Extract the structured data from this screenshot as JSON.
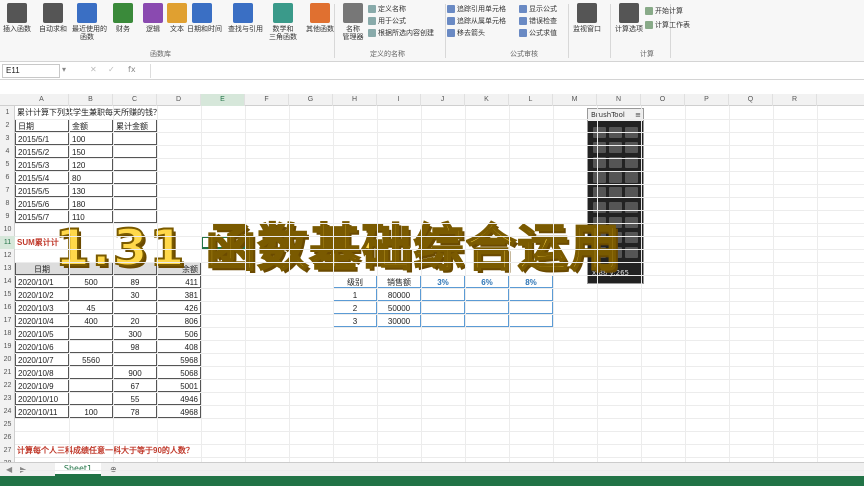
{
  "ribbon": {
    "buttons": [
      {
        "label": "插入函数",
        "color": "#555"
      },
      {
        "label": "自动求和",
        "color": "#555"
      },
      {
        "label": "最近使用的\n函数",
        "color": "#3a6fc4"
      },
      {
        "label": "财务",
        "color": "#3a8a3a"
      },
      {
        "label": "逻辑",
        "color": "#8a4ab0"
      },
      {
        "label": "文本",
        "color": "#e0a030"
      },
      {
        "label": "日期和时间",
        "color": "#3a6fc4"
      },
      {
        "label": "查找与引用",
        "color": "#3a6fc4"
      },
      {
        "label": "数学和\n三角函数",
        "color": "#3a9a8a"
      },
      {
        "label": "其他函数",
        "color": "#e07030"
      },
      {
        "label": "名称\n管理器",
        "color": "#777"
      },
      {
        "label": "监视窗口",
        "color": "#555"
      },
      {
        "label": "计算选项",
        "color": "#555"
      }
    ],
    "groups": {
      "library": "函数库",
      "names": "定义的名称",
      "audit": "公式审核",
      "calc": "计算"
    },
    "names_items": [
      "定义名称",
      "用于公式",
      "根据所选内容创建"
    ],
    "audit_items": [
      "追踪引用单元格",
      "追踪从属单元格",
      "移去箭头",
      "显示公式",
      "错误检查",
      "公式求值"
    ],
    "calc_items": [
      "开始计算",
      "计算工作表"
    ]
  },
  "formula_bar": {
    "name_box": "E11",
    "fx": "fx",
    "value": ""
  },
  "columns": [
    "A",
    "B",
    "C",
    "D",
    "E",
    "F",
    "G",
    "H",
    "I",
    "J",
    "K",
    "L",
    "M",
    "N",
    "O",
    "P",
    "Q",
    "R"
  ],
  "rows": [
    "1",
    "2",
    "3",
    "4",
    "5",
    "6",
    "7",
    "8",
    "9",
    "10",
    "11",
    "12",
    "13",
    "14",
    "15",
    "16",
    "17",
    "18",
    "19",
    "20",
    "21",
    "22",
    "23",
    "24",
    "25",
    "26",
    "27",
    "28"
  ],
  "sheet": {
    "q1": "累计计算下列某学生兼职每天所赚的钱？",
    "t1_header": [
      "日期",
      "金额",
      "累计金额"
    ],
    "t1": [
      [
        "2015/5/1",
        "100"
      ],
      [
        "2015/5/2",
        "150"
      ],
      [
        "2015/5/3",
        "120"
      ],
      [
        "2015/5/4",
        "80"
      ],
      [
        "2015/5/5",
        "130"
      ],
      [
        "2015/5/6",
        "180"
      ],
      [
        "2015/5/7",
        "110"
      ]
    ],
    "q2": "SUM累计计",
    "t2_header": [
      "日期",
      "余额"
    ],
    "t2": [
      [
        "2020/10/1",
        "500",
        "89",
        "411"
      ],
      [
        "2020/10/2",
        "",
        "30",
        "381"
      ],
      [
        "2020/10/3",
        "45",
        "",
        "426"
      ],
      [
        "2020/10/4",
        "400",
        "20",
        "806"
      ],
      [
        "2020/10/5",
        "",
        "300",
        "506"
      ],
      [
        "2020/10/6",
        "",
        "98",
        "408"
      ],
      [
        "2020/10/7",
        "5560",
        "",
        "5968"
      ],
      [
        "2020/10/8",
        "",
        "900",
        "5068"
      ],
      [
        "2020/10/9",
        "",
        "67",
        "5001"
      ],
      [
        "2020/10/10",
        "",
        "55",
        "4946"
      ],
      [
        "2020/10/11",
        "100",
        "78",
        "4968"
      ]
    ],
    "q3": "计算每个人三科成绩任意一科大于等于90的人数？",
    "t3_header": [
      "级别",
      "销售额",
      "3%",
      "6%",
      "8%"
    ],
    "t3": [
      [
        "1",
        "80000"
      ],
      [
        "2",
        "50000"
      ],
      [
        "3",
        "30000"
      ]
    ]
  },
  "brushtool": {
    "title": "BrushTool",
    "readout": "x:88 y:265"
  },
  "overlay_title": "1.31 函数基础综合运用",
  "tabs": {
    "sheet1": "Sheet1"
  }
}
